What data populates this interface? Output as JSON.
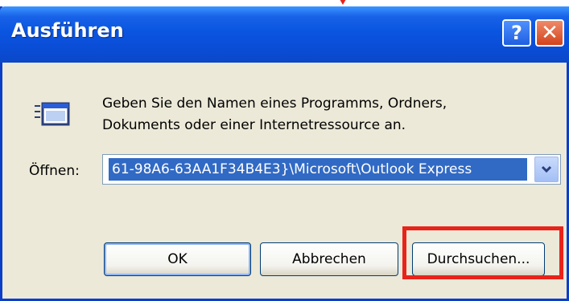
{
  "window": {
    "title": "Ausführen",
    "help_symbol": "?",
    "close_symbol": "✕"
  },
  "icons": {
    "run": "run-program-icon",
    "help": "help-icon",
    "close": "close-icon",
    "dropdown": "chevron-down-icon"
  },
  "dialog": {
    "message_line1": "Geben Sie den Namen eines Programms, Ordners,",
    "message_line2": "Dokuments oder einer Internetressource an.",
    "open_label": "Öffnen:",
    "open_value": "61-98A6-63AA1F34B4E3}\\Microsoft\\Outlook Express"
  },
  "buttons": {
    "ok": "OK",
    "cancel": "Abbrechen",
    "browse": "Durchsuchen..."
  },
  "colors": {
    "titlebar": "#0a55e0",
    "selection": "#316ac5",
    "highlight": "#e8231a",
    "dialog_bg": "#ece9d8"
  }
}
